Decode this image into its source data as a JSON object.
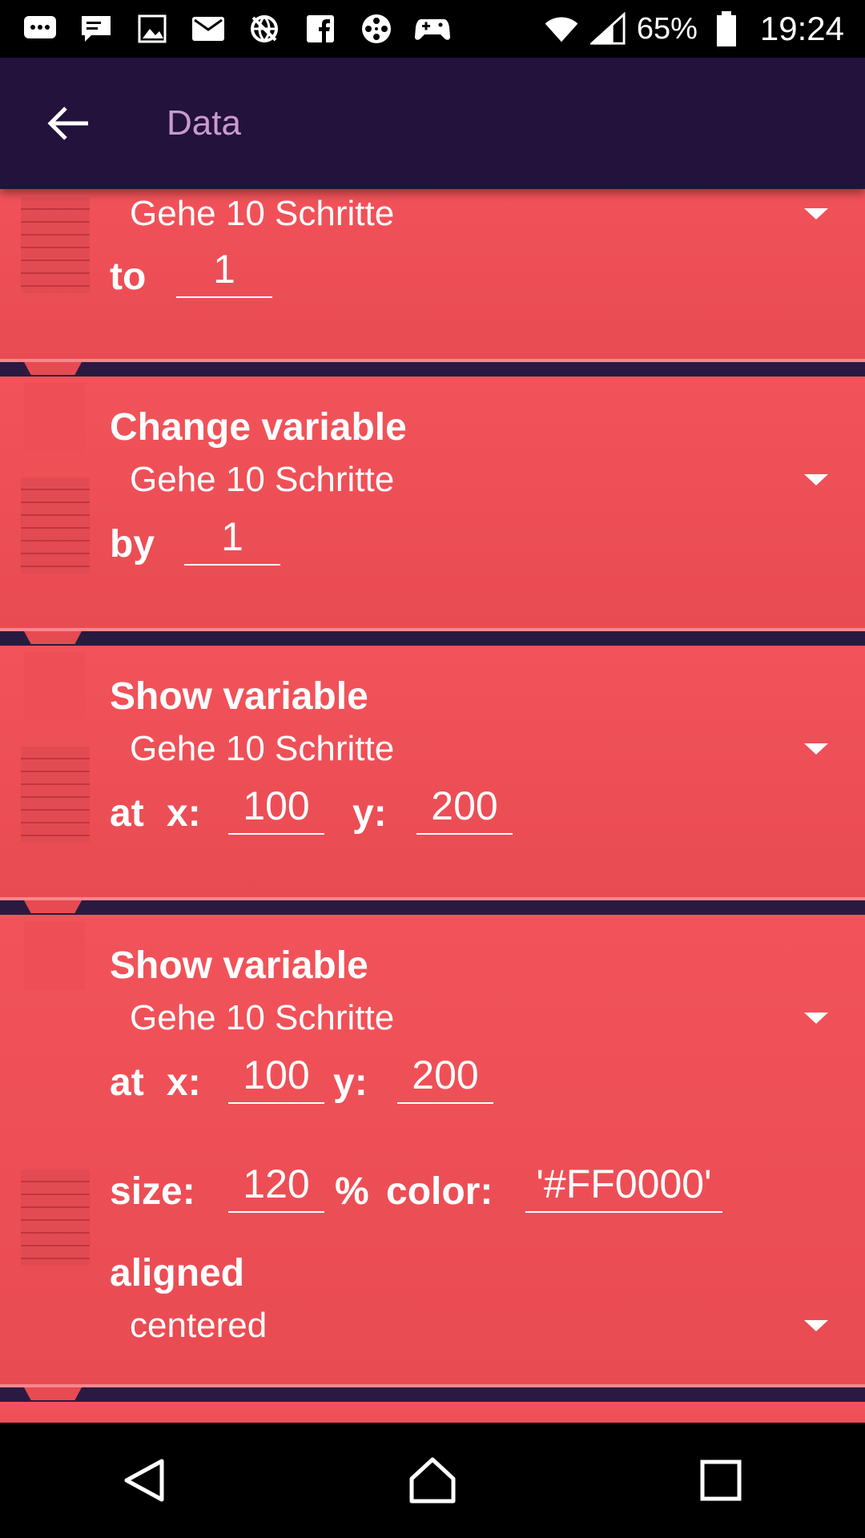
{
  "status_bar": {
    "icons": [
      "chat-bubble-icon",
      "message-icon",
      "image-icon",
      "mail-icon",
      "globe-off-icon",
      "facebook-icon",
      "film-reel-icon",
      "game-controller-icon"
    ],
    "battery_percent": "65%",
    "time": "19:24"
  },
  "toolbar": {
    "title": "Data"
  },
  "bricks": {
    "set_variable": {
      "variable": "Gehe 10 Schritte",
      "to_label": "to",
      "to_value": "1"
    },
    "change_variable": {
      "title": "Change variable",
      "variable": "Gehe 10 Schritte",
      "by_label": "by",
      "by_value": "1"
    },
    "show_variable_1": {
      "title": "Show variable",
      "variable": "Gehe 10 Schritte",
      "at_label": "at",
      "x_label": "x:",
      "x_value": "100",
      "y_label": "y:",
      "y_value": "200"
    },
    "show_variable_2": {
      "title": "Show variable",
      "variable": "Gehe 10 Schritte",
      "at_label": "at",
      "x_label": "x:",
      "x_value": "100",
      "y_label": "y:",
      "y_value": "200",
      "size_label": "size:",
      "size_value": "120",
      "percent_label": "%",
      "color_label": "color:",
      "color_value": "'#FF0000'",
      "aligned_label": "aligned",
      "aligned_value": "centered"
    }
  },
  "colors": {
    "brick": "#f2535a",
    "toolbar": "#22123c",
    "title": "#c89ad0"
  }
}
